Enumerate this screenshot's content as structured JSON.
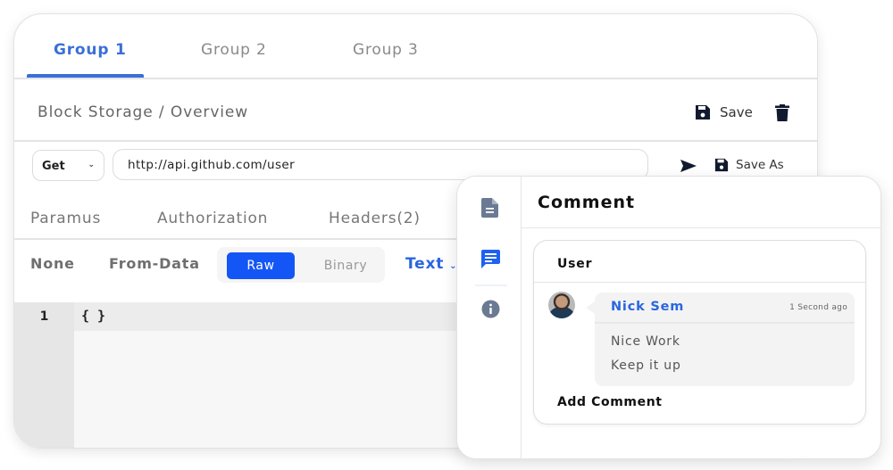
{
  "tabs": [
    {
      "label": "Group 1",
      "active": true
    },
    {
      "label": "Group 2",
      "active": false
    },
    {
      "label": "Group 3",
      "active": false
    }
  ],
  "breadcrumb": "Block Storage / Overview",
  "toolbar": {
    "save_label": "Save",
    "save_icon": "floppy-disk-icon",
    "delete_icon": "trash-icon"
  },
  "request": {
    "method": "Get",
    "url": "http://api.github.com/user",
    "send_icon": "send-icon",
    "save_as_label": "Save As"
  },
  "sub_tabs": [
    {
      "label": "Paramus"
    },
    {
      "label": "Authorization"
    },
    {
      "label": "Headers(2)"
    }
  ],
  "body_types": {
    "none": "None",
    "form_data": "From-Data",
    "raw": "Raw",
    "binary": "Binary",
    "selected": "Raw",
    "format": "Text"
  },
  "editor": {
    "lines": [
      {
        "number": "1",
        "code": "{ }"
      }
    ]
  },
  "comment_panel": {
    "rail_icons": [
      "document-icon",
      "chat-icon",
      "info-icon"
    ],
    "active_rail_icon": "chat-icon",
    "title": "Comment",
    "user_label": "User",
    "comments": [
      {
        "author": "Nick Sem",
        "time": "1 Second ago",
        "lines": [
          "Nice Work",
          "Keep it up"
        ]
      }
    ],
    "add_comment_label": "Add Comment"
  },
  "colors": {
    "accent": "#3a6fd8",
    "raw_button": "#1456f5",
    "link_blue": "#2a66e0",
    "icon_gray": "#6b7a93"
  }
}
